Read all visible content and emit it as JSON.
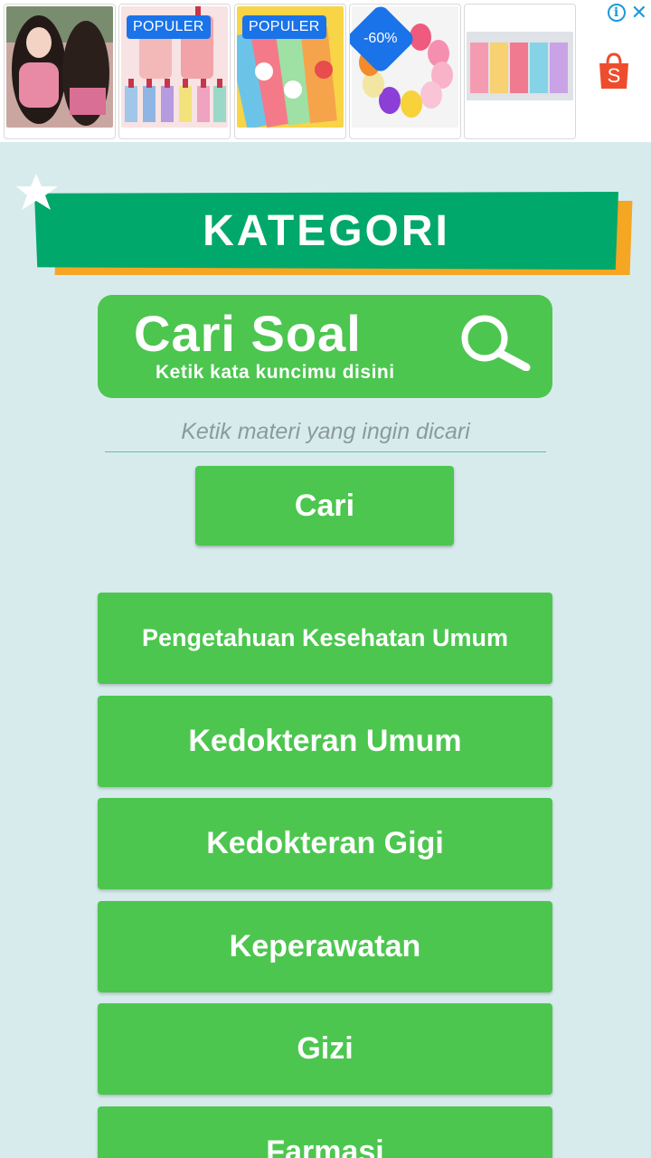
{
  "ad": {
    "cards": [
      {
        "badge": ""
      },
      {
        "badge": "POPULER"
      },
      {
        "badge": "POPULER"
      },
      {
        "badge": "-60%"
      },
      {
        "badge": ""
      }
    ],
    "info_icon": "info-icon",
    "close_icon": "close-icon",
    "shopee_letter": "S"
  },
  "header": {
    "title": "KATEGORI"
  },
  "search_banner": {
    "title": "Cari Soal",
    "subtitle": "Ketik kata kuncimu disini"
  },
  "search": {
    "placeholder": "Ketik materi yang ingin dicari",
    "button_label": "Cari"
  },
  "categories": [
    {
      "label": "Pengetahuan Kesehatan Umum"
    },
    {
      "label": "Kedokteran Umum"
    },
    {
      "label": "Kedokteran Gigi"
    },
    {
      "label": "Keperawatan"
    },
    {
      "label": "Gizi"
    },
    {
      "label": "Farmasi"
    }
  ],
  "colors": {
    "background": "#d7ebed",
    "green_button": "#4cc64f",
    "header_green": "#00a86b",
    "header_orange": "#f5a623",
    "ad_badge_blue": "#1a73e8",
    "shopee_orange": "#ee4d2d"
  }
}
